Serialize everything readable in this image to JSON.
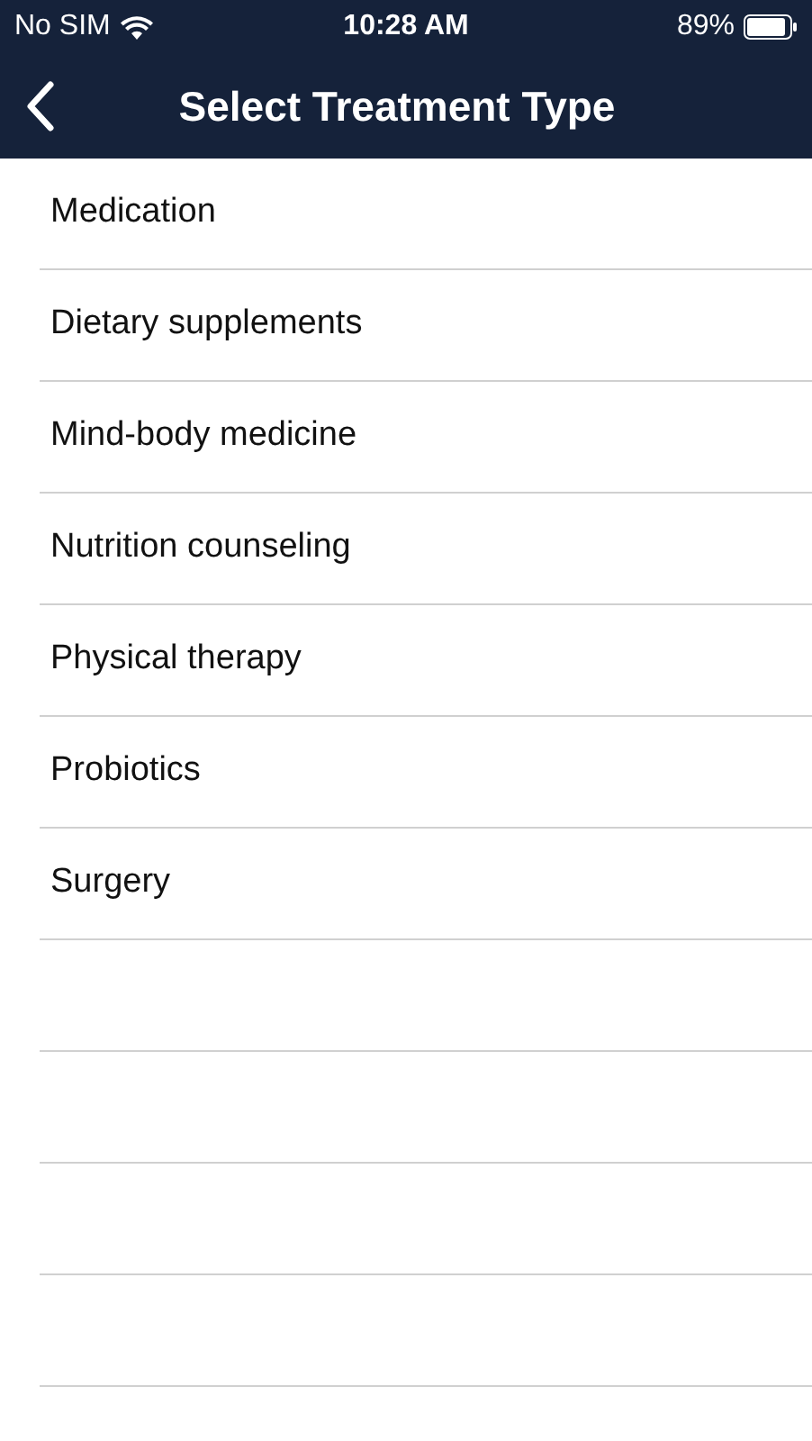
{
  "status_bar": {
    "carrier": "No SIM",
    "time": "10:28 AM",
    "battery": "89%"
  },
  "nav_bar": {
    "title": "Select Treatment Type"
  },
  "list": {
    "items": [
      "Medication",
      "Dietary supplements",
      "Mind-body medicine",
      "Nutrition counseling",
      "Physical therapy",
      "Probiotics",
      "Surgery"
    ]
  }
}
